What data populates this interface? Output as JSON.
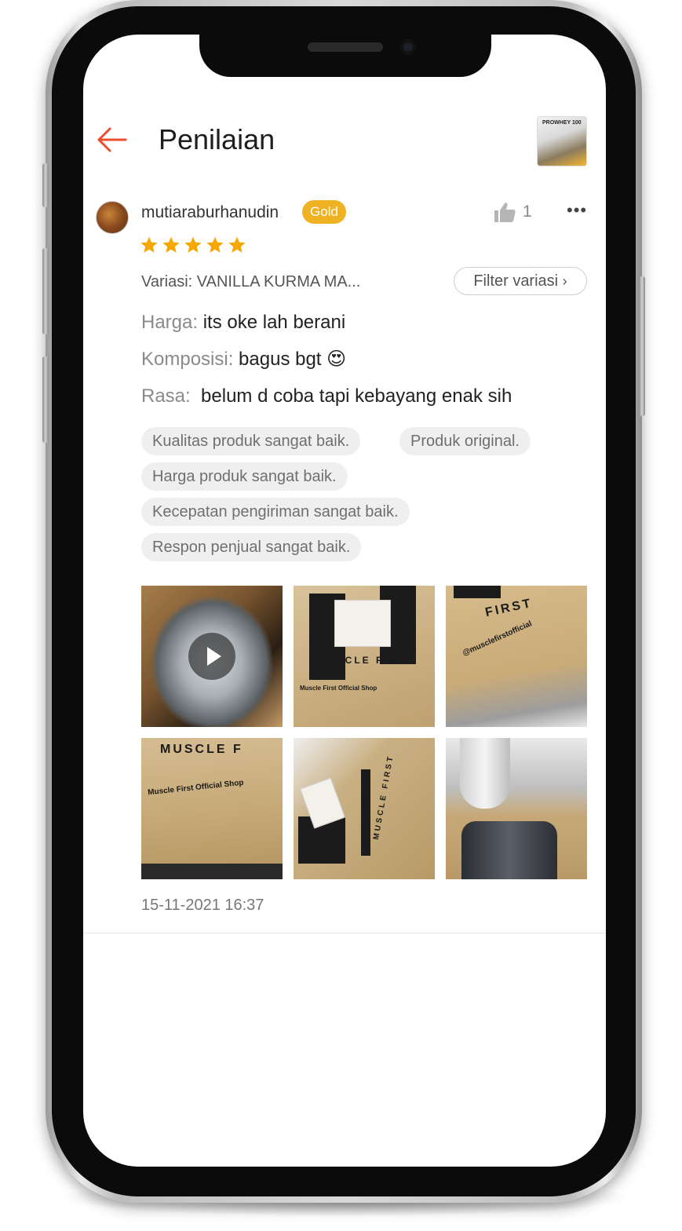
{
  "header": {
    "title": "Penilaian",
    "product_thumb_text": "PROWHEY 100"
  },
  "review": {
    "username": "mutiaraburhanudin",
    "badge": "Gold",
    "likes": "1",
    "rating": 5,
    "variation": "Variasi: VANILLA KURMA MA...",
    "filter_label": "Filter variasi",
    "lines": [
      {
        "key": "Harga:",
        "value": "its oke lah berani"
      },
      {
        "key": "Komposisi:",
        "value": "bagus bgt 😍"
      },
      {
        "key": "Rasa:",
        "value": " belum d coba tapi kebayang enak sih"
      }
    ],
    "tags": [
      "Kualitas produk sangat baik.",
      "Produk original.",
      "Harga produk sangat baik.",
      "Kecepatan pengiriman sangat baik.",
      "Respon penjual sangat baik."
    ],
    "photo_texts": {
      "p2": "MUSCLE FIRST",
      "p2b": "Muscle First Official Shop",
      "p3": "FIRST",
      "p3b": "@musclefirstofficial",
      "p4": "MUSCLE F",
      "p4b": "Muscle First Official Shop",
      "p5": "MUSCLE FIRST"
    },
    "timestamp": "15-11-2021 16:37"
  },
  "colors": {
    "accent": "#ee4d2d",
    "gold_badge": "#efb223",
    "star": "#f6a700"
  }
}
